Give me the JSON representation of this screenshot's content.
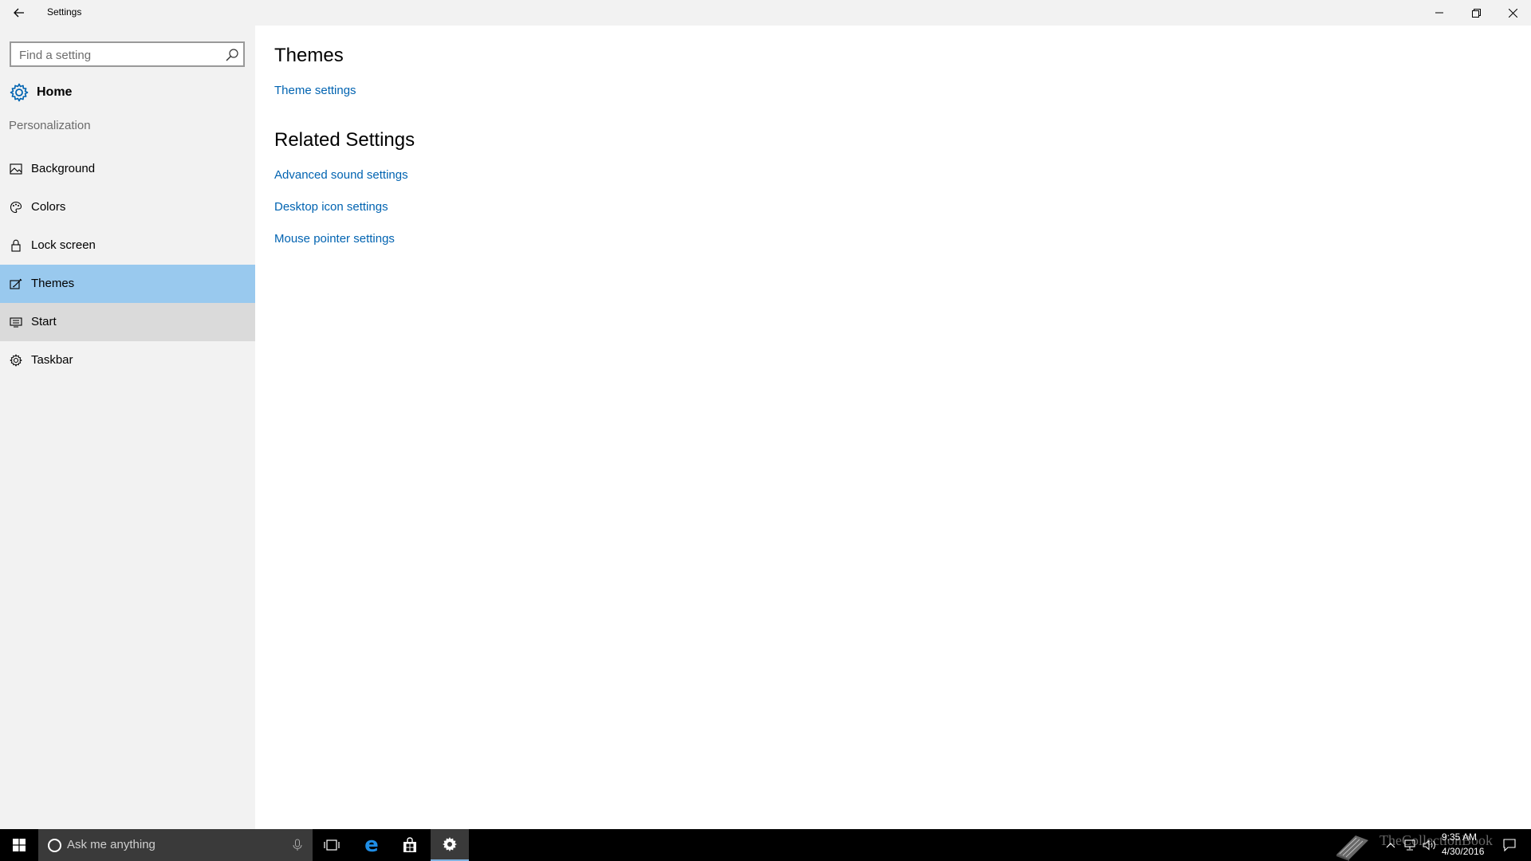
{
  "window": {
    "title": "Settings"
  },
  "sidebar": {
    "search_placeholder": "Find a setting",
    "home_label": "Home",
    "section_label": "Personalization",
    "items": [
      {
        "label": "Background",
        "icon": "picture-icon"
      },
      {
        "label": "Colors",
        "icon": "palette-icon"
      },
      {
        "label": "Lock screen",
        "icon": "lock-icon"
      },
      {
        "label": "Themes",
        "icon": "themes-brush-icon",
        "selected": true
      },
      {
        "label": "Start",
        "icon": "start-menu-icon"
      },
      {
        "label": "Taskbar",
        "icon": "taskbar-gear-icon"
      }
    ]
  },
  "main": {
    "themes_heading": "Themes",
    "theme_settings_link": "Theme settings",
    "related_heading": "Related Settings",
    "related_links": [
      "Advanced sound settings",
      "Desktop icon settings",
      "Mouse pointer settings"
    ]
  },
  "taskbar": {
    "search_text": "Ask me anything",
    "time": "9:35 AM",
    "date": "4/30/2016",
    "watermark": "TheCollectionBook"
  },
  "colors": {
    "accent": "#0063b1",
    "selected_bg": "#99c9ee",
    "sidebar_bg": "#f2f2f2",
    "taskbar_bg": "#000000"
  }
}
